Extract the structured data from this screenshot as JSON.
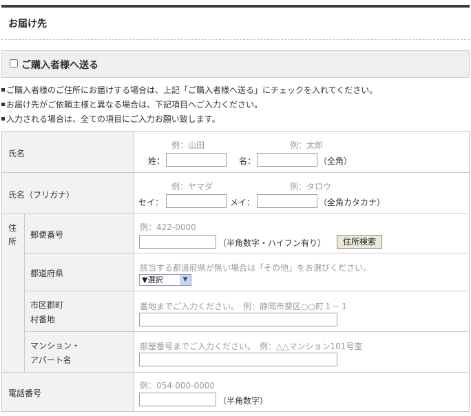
{
  "section_title": "お届け先",
  "same_as_buyer": {
    "label": "ご購入者様へ送る",
    "checked": false
  },
  "notes": [
    "ご購入者様のご住所にお届けする場合は、上記「ご購入者様へ送る」にチェックを入れてください。",
    "お届け先がご依頼主様と異なる場合は、下記項目へご入力ください。",
    "入力される場合は、全ての項目にご入力お願い致します。"
  ],
  "name": {
    "label": "氏名",
    "sei_example": "例：山田",
    "mei_example": "例：太郎",
    "sei_label": "姓：",
    "mei_label": "名：",
    "sei_value": "",
    "mei_value": "",
    "note": "（全角）"
  },
  "kana": {
    "label": "氏名（フリガナ）",
    "sei_example": "例：ヤマダ",
    "mei_example": "例：タロウ",
    "sei_label": "セイ：",
    "mei_label": "メイ：",
    "sei_value": "",
    "mei_value": "",
    "note": "（全角カタカナ）"
  },
  "address": {
    "label": "住所",
    "postal": {
      "label": "郵便番号",
      "example": "例：422-0000",
      "value": "",
      "note": "（半角数字・ハイフン有り）",
      "search_button": "住所検索"
    },
    "prefecture": {
      "label": "都道府県",
      "hint": "該当する都道府県が無い場合は「その他」をお選びください。",
      "selected": "▼選択"
    },
    "city": {
      "label_line1": "市区郡町",
      "label_line2": "村番地",
      "hint": "番地までご入力ください。　例：静岡市葵区○○町１－１",
      "value": ""
    },
    "building": {
      "label_line1": "マンション・",
      "label_line2": "アパート名",
      "hint": "部屋番号までご入力ください。　例：△△マンション101号室",
      "value": ""
    }
  },
  "phone": {
    "label": "電話番号",
    "example": "例：054-000-0000",
    "value": "",
    "note": "（半角数字）"
  }
}
